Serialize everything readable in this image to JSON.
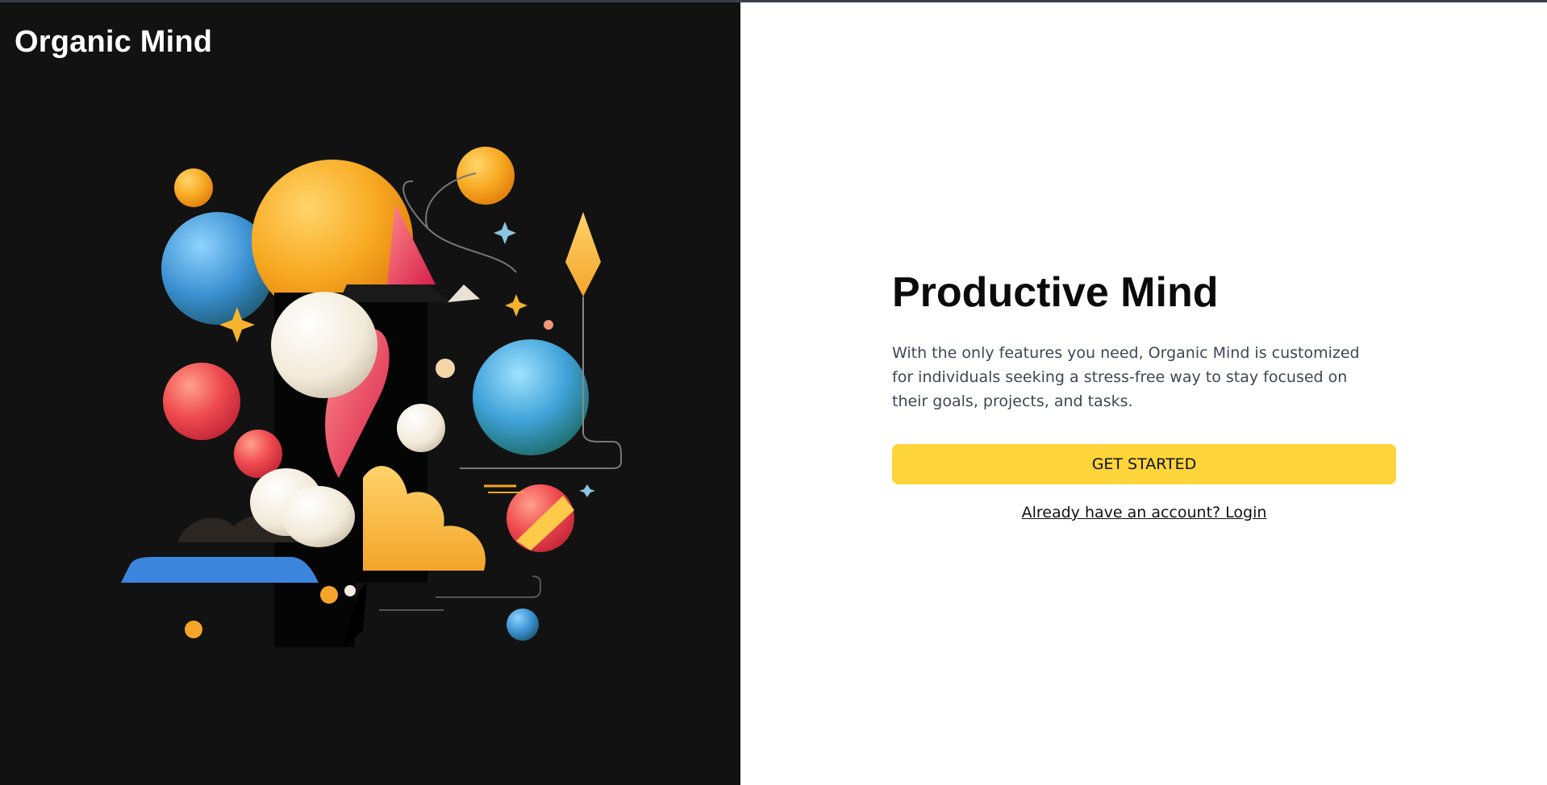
{
  "brand": {
    "logo_text": "Organic Mind"
  },
  "hero": {
    "title": "Productive Mind",
    "description": "With the only features you need, Organic Mind is customized for individuals seeking a stress-free way to stay focused on their goals, projects, and tasks.",
    "cta_label": "GET STARTED",
    "login_link": "Already have an account? Login"
  },
  "colors": {
    "left_panel_bg": "#121212",
    "cta_bg": "#fdd53a",
    "heading": "#0b0b0b",
    "body_text": "#3f4753"
  },
  "illustration": {
    "icon": "abstract-shapes-illustration"
  }
}
